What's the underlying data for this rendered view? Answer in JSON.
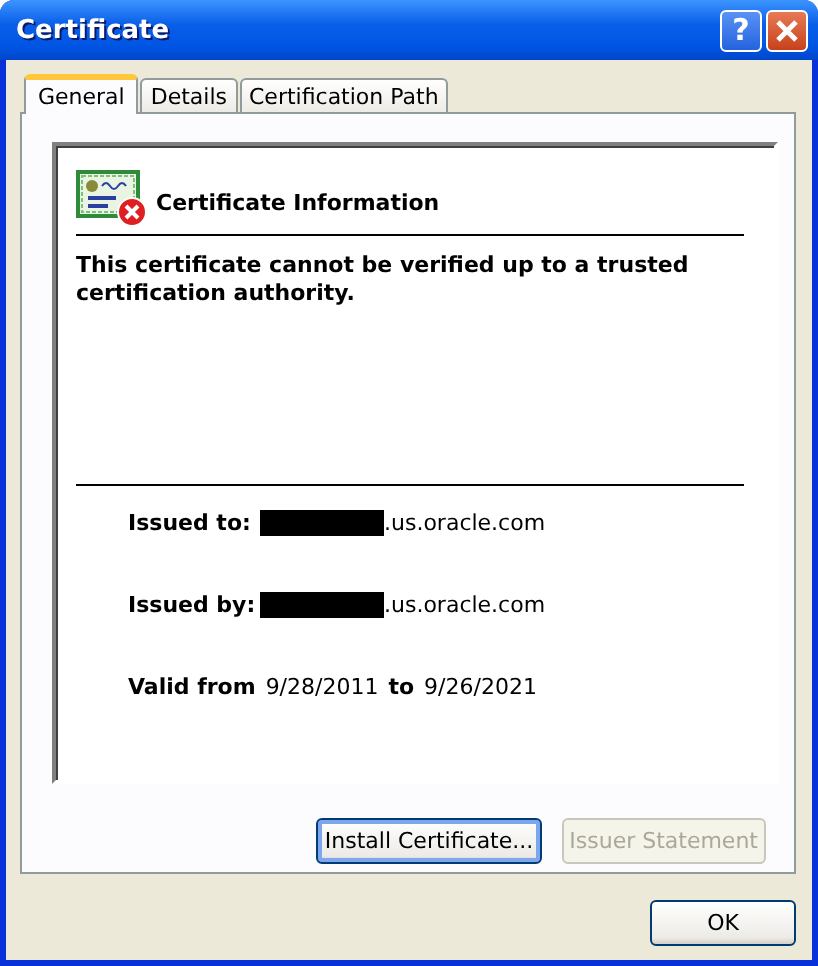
{
  "window": {
    "title": "Certificate"
  },
  "title_buttons": [
    {
      "kind": "help",
      "label": "?"
    },
    {
      "kind": "close"
    }
  ],
  "tabs": [
    {
      "label": "General",
      "selected": true
    },
    {
      "label": "Details",
      "selected": false
    },
    {
      "label": "Certification Path",
      "selected": false
    }
  ],
  "header": {
    "title": "Certificate Information"
  },
  "message": "This certificate cannot be verified up to a trusted certification authority.",
  "fields": [
    {
      "label": "Issued to:",
      "value": ".us.oracle.com",
      "redacted": true
    },
    {
      "label": "Issued by:",
      "value": ".us.oracle.com",
      "redacted": true
    }
  ],
  "validity": {
    "from_label": "Valid from",
    "from": "9/28/2011",
    "to_label": "to",
    "to": "9/26/2021"
  },
  "buttons": [
    {
      "label": "Install Certificate...",
      "disabled": false,
      "focused": true
    },
    {
      "label": "Issuer Statement",
      "disabled": true,
      "focused": false
    }
  ],
  "dialog_buttons": [
    {
      "label": "OK",
      "disabled": false,
      "focused": false
    }
  ]
}
